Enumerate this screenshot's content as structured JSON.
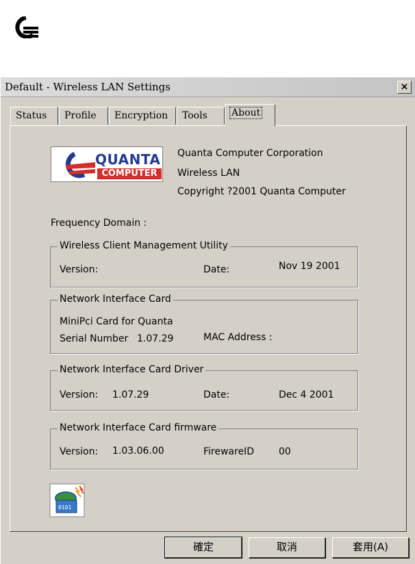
{
  "window": {
    "title": "Default - Wireless LAN Settings",
    "close_label": "×"
  },
  "tabs": [
    {
      "label": "Status"
    },
    {
      "label": "Profile"
    },
    {
      "label": "Encryption"
    },
    {
      "label": "Tools"
    },
    {
      "label": "About",
      "active": true
    }
  ],
  "about": {
    "logo": {
      "word1": "QUANTA",
      "word2": "COMPUTER"
    },
    "company": "Quanta Computer Corporation",
    "product": "Wireless LAN",
    "copyright": "Copyright ?2001  Quanta Computer",
    "frequency_label": "Frequency Domain :",
    "utility": {
      "title": "Wireless Client Management Utility",
      "version_label": "Version:",
      "date_label": "Date:",
      "date_value": "Nov 19 2001"
    },
    "nic": {
      "title": "Network Interface Card",
      "card_name": "MiniPci Card for Quanta",
      "serial_label": "Serial Number",
      "serial_value": "1.07.29",
      "mac_label": "MAC Address :"
    },
    "driver": {
      "title": "Network Interface Card Driver",
      "version_label": "Version:",
      "version_value": "1.07.29",
      "date_label": "Date:",
      "date_value": "Dec  4 2001"
    },
    "firmware": {
      "title": "Network Interface Card firmware",
      "version_label": "Version:",
      "version_value": "1.03.06.00",
      "id_label": "FirewareID",
      "id_value": "00"
    }
  },
  "buttons": {
    "ok": "確定",
    "cancel": "取消",
    "apply": "套用(A)"
  },
  "icons": {
    "brand": "quanta-logo-icon",
    "app": "network-card-icon"
  },
  "colors": {
    "brand_blue": "#233a8f",
    "brand_red": "#d42d2a",
    "dialog_bg": "#d4d0c8"
  }
}
